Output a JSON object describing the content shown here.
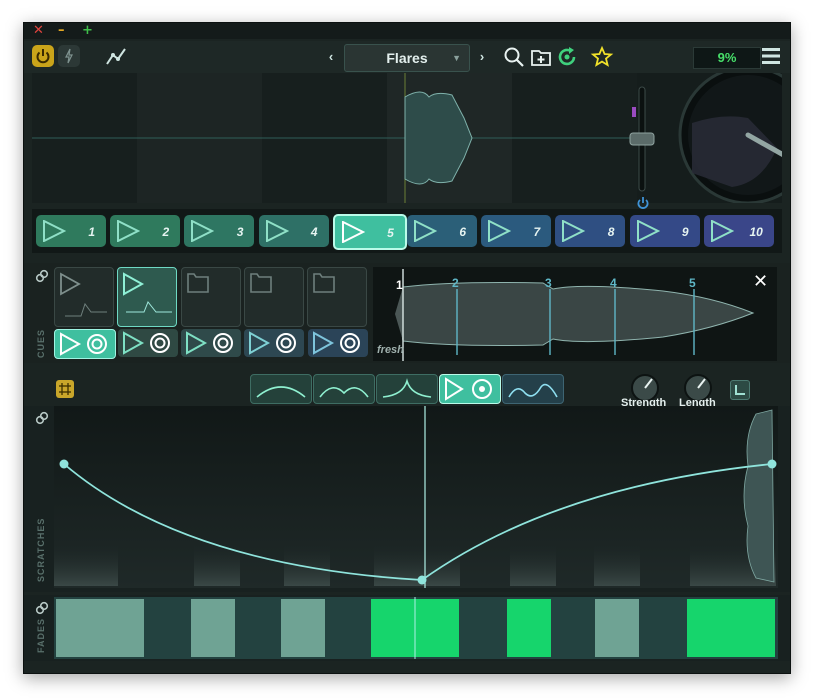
{
  "window": {
    "controls": {
      "close": "✕",
      "minimize": "–",
      "maximize": "+"
    }
  },
  "toolbar": {
    "prev": "‹",
    "next": "›",
    "preset_name": "Flares",
    "cpu_percent": "9%",
    "icons": [
      "power-icon",
      "bolt-icon",
      "automation-icon",
      "search-icon",
      "add-folder-icon",
      "refresh-icon",
      "star-icon",
      "menu-icon"
    ]
  },
  "pads": [
    {
      "label": "1",
      "color": "#2f7a5d"
    },
    {
      "label": "2",
      "color": "#2f7a5d"
    },
    {
      "label": "3",
      "color": "#2e7662"
    },
    {
      "label": "4",
      "color": "#2e7066"
    },
    {
      "label": "5",
      "color": "#3fbf9f",
      "active": true
    },
    {
      "label": "6",
      "color": "#2b5f78"
    },
    {
      "label": "7",
      "color": "#2b5a7e"
    },
    {
      "label": "8",
      "color": "#2f4f82"
    },
    {
      "label": "9",
      "color": "#344987"
    },
    {
      "label": "10",
      "color": "#3a4689"
    }
  ],
  "cues": {
    "section_label": "CUES",
    "wave_label": "fresh",
    "markers": [
      "1",
      "2",
      "3",
      "4",
      "5"
    ],
    "close": "✕"
  },
  "shapes": {
    "knobs": {
      "strength": "Strength",
      "length": "Length"
    }
  },
  "scratches": {
    "section_label": "SCRATCHES"
  },
  "fades": {
    "section_label": "FADES"
  },
  "colors": {
    "accent": "#5fd6c8",
    "green": "#16d56c",
    "panel": "#1b2422"
  }
}
